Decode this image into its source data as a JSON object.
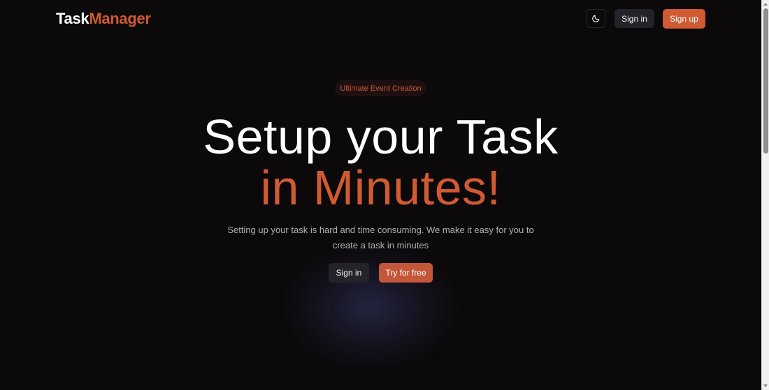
{
  "header": {
    "logo_part1": "Task",
    "logo_part2": "Manager",
    "theme_icon": "moon-icon",
    "signin_label": "Sign in",
    "signup_label": "Sign up"
  },
  "hero": {
    "badge": "Ultimate Event Creation",
    "title_line1": "Setup your Task",
    "title_line2": "in Minutes!",
    "subtitle_line1": "Setting up your task is hard and time consuming. We make it easy for you to",
    "subtitle_line2": "create a task in minutes",
    "signin_label": "Sign in",
    "try_label": "Try for free"
  },
  "colors": {
    "background": "#0c090a",
    "accent": "#d05a32",
    "button_dark": "#25232a"
  }
}
